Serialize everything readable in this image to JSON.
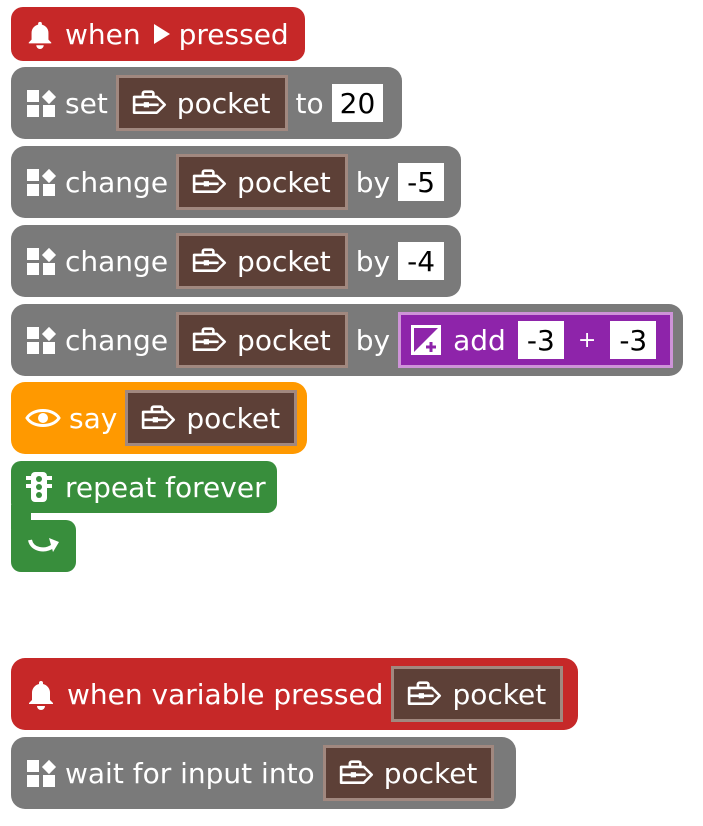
{
  "blocks": {
    "when_pressed": {
      "when_label": "when",
      "pressed_label": "pressed",
      "icon": "bell-icon",
      "play_icon": "play-icon"
    },
    "set_block": {
      "label": "set",
      "variable": "pocket",
      "to_label": "to",
      "value": "20"
    },
    "change1": {
      "label": "change",
      "variable": "pocket",
      "by_label": "by",
      "value": "-5"
    },
    "change2": {
      "label": "change",
      "variable": "pocket",
      "by_label": "by",
      "value": "-4"
    },
    "change3": {
      "label": "change",
      "variable": "pocket",
      "by_label": "by",
      "add_label": "add",
      "left": "-3",
      "op": "+",
      "right": "-3"
    },
    "say_block": {
      "label": "say",
      "variable": "pocket",
      "icon": "eye-icon"
    },
    "repeat_block": {
      "label": "repeat forever",
      "icon": "traffic-light-icon",
      "end_icon": "loop-arrow-icon"
    },
    "when_variable": {
      "label": "when variable pressed",
      "variable": "pocket"
    },
    "wait_input": {
      "label": "wait for input into",
      "variable": "pocket"
    }
  },
  "colors": {
    "events": "#c62828",
    "variables": "#7a7a7a",
    "variable_pill": "#5d4037",
    "variable_border": "#a1887f",
    "looks": "#ff9900",
    "control": "#388e3c",
    "math": "#8e24aa"
  }
}
